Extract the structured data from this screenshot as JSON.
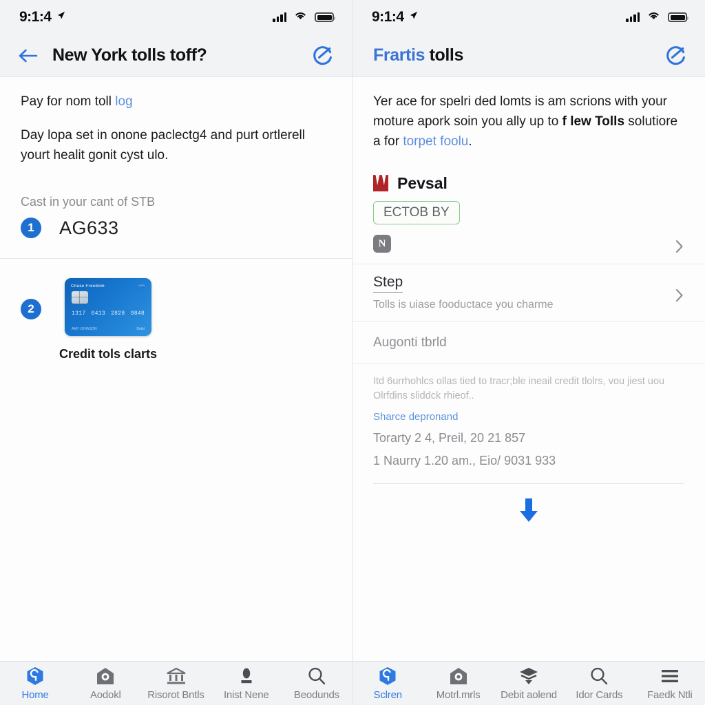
{
  "theme": {
    "accent_blue": "#2f7ae0",
    "badge_blue": "#1f6fd0",
    "link_blue": "#5b8fdd",
    "brand_red": "#b02427",
    "badge_green_border": "#8cc98f",
    "bar_bg": "#f2f3f5",
    "page_bg": "#fdfdfd"
  },
  "left": {
    "status": {
      "time": "9:1:4",
      "location_icon": "location-arrow-icon",
      "signal_icon": "cellular-signal-icon",
      "wifi_icon": "wifi-icon",
      "battery_icon": "battery-icon"
    },
    "nav": {
      "back_icon": "back-arrow-icon",
      "title": "New York tolls toff?",
      "action_icon": "sync-icon"
    },
    "intro": {
      "text": "Pay for nom toll",
      "link": "log"
    },
    "paragraph": "Day lopa set in onone paclectg4 and purt ortlerell yourt healit gonit cyst ulo.",
    "section_label": "Cast in your cant of STB",
    "step1": {
      "number": "1",
      "code": "AG633"
    },
    "step2": {
      "number": "2",
      "caption": "Credit tols clarts",
      "card": {
        "brand": "Chase Freedom",
        "mark_label": "VISA",
        "number_groups": [
          "1317",
          "0413",
          "2828",
          "9848"
        ],
        "holder": "AMY JOHNSON",
        "network": "Debit"
      }
    },
    "tabs": [
      {
        "label": "Home",
        "icon": "app-home-icon",
        "active": true
      },
      {
        "label": "Aodokl",
        "icon": "camera-home-icon",
        "active": false
      },
      {
        "label": "Risorot Bntls",
        "icon": "bank-building-icon",
        "active": false
      },
      {
        "label": "Inist Nene",
        "icon": "person-icon",
        "active": false
      },
      {
        "label": "Beodunds",
        "icon": "search-icon",
        "active": false
      }
    ]
  },
  "right": {
    "status": {
      "time": "9:1:4",
      "location_icon": "location-arrow-icon",
      "signal_icon": "cellular-signal-icon",
      "wifi_icon": "wifi-icon",
      "battery_icon": "battery-icon"
    },
    "nav": {
      "title_accent": "Frartis",
      "title_rest": "tolls",
      "action_icon": "sync-icon"
    },
    "intro": {
      "part1": "Yer ace for spelri ded lomts is am scrions with your moture apork soin you ally up to ",
      "bold": "f lew Tolls",
      "part2": " solutiore a for ",
      "link": "torpet foolu",
      "tail": "."
    },
    "brand": {
      "logo_icon": "wells-fargo-logo-icon",
      "name": "Pevsal"
    },
    "tag_badge": "ECTOB BY",
    "row_app": {
      "tile_icon": "app-tile-n-icon",
      "chevron": "chevron-right-icon"
    },
    "row_step": {
      "title": "Step",
      "subtitle": "Tolls is uiase fooductace you charme",
      "chevron": "chevron-right-icon"
    },
    "sub_head": "Augonti tbrld",
    "fine_print": "Itd 6urrhohlcs ollas tied to tracr;ble ineail credit tlolrs, vou jiest uou Olrfdins sliddck rhieof..",
    "fine_link": "Sharce depronand",
    "meta_lines": [
      "Torarty 2 4, Preil, 20 21 857",
      "1 Naurry 1.20 am., Eio/ 9031 933"
    ],
    "download_icon": "download-arrow-icon",
    "tabs": [
      {
        "label": "Sclren",
        "icon": "app-home-icon",
        "active": true
      },
      {
        "label": "Motrl.mrls",
        "icon": "camera-home-icon",
        "active": false
      },
      {
        "label": "Debit aolend",
        "icon": "layers-icon",
        "active": false
      },
      {
        "label": "Idor Cards",
        "icon": "search-icon",
        "active": false
      },
      {
        "label": "Faedk Ntli",
        "icon": "menu-hamburger-icon",
        "active": false
      }
    ]
  }
}
